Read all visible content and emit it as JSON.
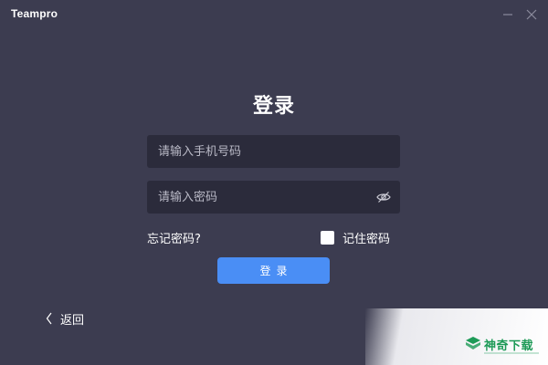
{
  "window": {
    "title": "Teampro"
  },
  "login": {
    "heading": "登录",
    "phone_placeholder": "请输入手机号码",
    "phone_value": "",
    "password_placeholder": "请输入密码",
    "password_value": "",
    "forgot_label": "忘记密码?",
    "remember_label": "记住密码",
    "remember_checked": false,
    "submit_label": "登录",
    "back_label": "返回"
  },
  "icons": {
    "minimize": "minimize-icon",
    "close": "close-icon",
    "password_visibility": "eye-off-icon",
    "back": "chevron-left-icon"
  },
  "watermark": {
    "text": "神奇下载"
  },
  "colors": {
    "background": "#3c3c50",
    "input_background": "#2b2b3b",
    "primary": "#4a8ef5",
    "text": "#ffffff",
    "placeholder": "#b9b9c6",
    "watermark_green": "#1d9a57"
  }
}
